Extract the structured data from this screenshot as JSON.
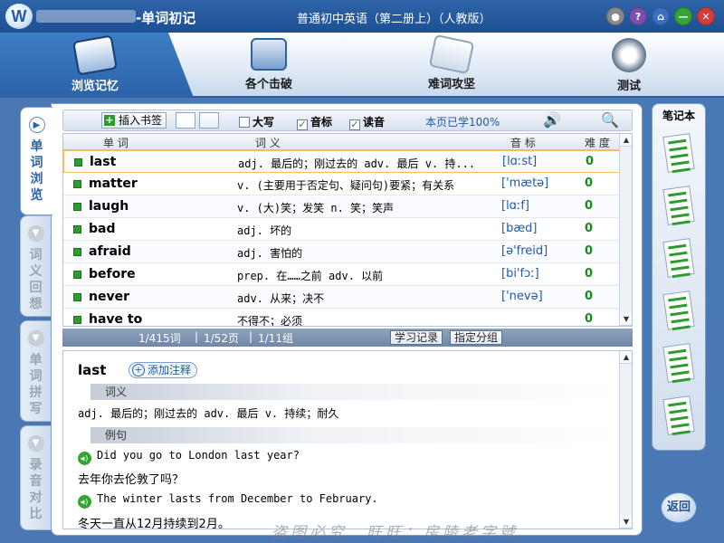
{
  "titlebar": {
    "logo": "W",
    "app_title": "-单词初记",
    "book_title": "普通初中英语（第二册上）（人教版）",
    "buttons": [
      {
        "name": "minimize-to-tray-button",
        "glyph": "●",
        "color": "#8a8a8a"
      },
      {
        "name": "help-button",
        "glyph": "?",
        "color": "#7a4fb0"
      },
      {
        "name": "home-button",
        "glyph": "⌂",
        "color": "#3b6fc4"
      },
      {
        "name": "minimize-button",
        "glyph": "—",
        "color": "#36a33a"
      },
      {
        "name": "close-button",
        "glyph": "✕",
        "color": "#d23c3c"
      }
    ]
  },
  "nav": {
    "tabs": [
      {
        "label": "浏览记忆",
        "icon": "abc-card-icon"
      },
      {
        "label": "各个击破",
        "icon": "target-flag-icon"
      },
      {
        "label": "难词攻坚",
        "icon": "pen-paper-icon"
      },
      {
        "label": "测试",
        "icon": "clock-trophy-icon"
      }
    ]
  },
  "sidetabs": [
    {
      "label": "单词浏览",
      "active": true
    },
    {
      "label": "词义回想",
      "active": false
    },
    {
      "label": "单词拼写",
      "active": false
    },
    {
      "label": "录音对比",
      "active": false
    }
  ],
  "toolbar": {
    "insert_bookmark": "插入书签",
    "uppercase": "大写",
    "phonetic": "音标",
    "reading": "读音",
    "progress": "本页已学100%"
  },
  "table": {
    "headers": [
      "单 词",
      "词 义",
      "音 标",
      "难 度"
    ],
    "rows": [
      {
        "word": "last",
        "def": "adj. 最后的；刚过去的 adv. 最后 v. 持...",
        "pho": "[lɑːst]",
        "diff": "0"
      },
      {
        "word": "matter",
        "def": "v. (主要用于否定句、疑问句)要紧；有关系",
        "pho": "['mætə]",
        "diff": "0"
      },
      {
        "word": "laugh",
        "def": "v. (大)笑；发笑 n. 笑；笑声",
        "pho": "[lɑːf]",
        "diff": "0"
      },
      {
        "word": "bad",
        "def": "adj. 坏的",
        "pho": "[bæd]",
        "diff": "0"
      },
      {
        "word": "afraid",
        "def": "adj. 害怕的",
        "pho": "[ə'freid]",
        "diff": "0"
      },
      {
        "word": "before",
        "def": "prep. 在……之前 adv. 以前",
        "pho": "[bi'fɔː]",
        "diff": "0"
      },
      {
        "word": "never",
        "def": "adv. 从来；决不",
        "pho": "['nevə]",
        "diff": "0"
      },
      {
        "word": "have to",
        "def": "不得不；必须",
        "pho": "",
        "diff": "0"
      }
    ]
  },
  "status": {
    "words": "1/415词",
    "pages": "1/52页",
    "groups": "1/11组",
    "study_record": "学习记录",
    "assign_group": "指定分组"
  },
  "detail": {
    "word": "last",
    "add_note": "添加注释",
    "meaning_head": "词义",
    "meaning": "adj. 最后的；刚过去的 adv. 最后 v. 持续；耐久",
    "example_head": "例句",
    "examples": [
      {
        "en": "Did you go to London last year?",
        "cn": "去年你去伦敦了吗？"
      },
      {
        "en": "The winter lasts from December to February.",
        "cn": "冬天一直从12月持续到2月。"
      }
    ]
  },
  "notebook": {
    "title": "笔记本",
    "back": "返回"
  },
  "watermark": "盗图必究　旺旺：房陵老字號"
}
